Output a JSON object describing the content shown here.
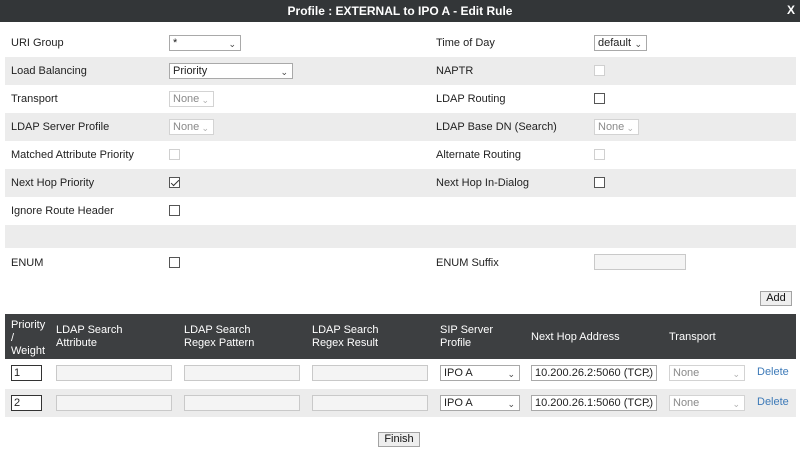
{
  "window": {
    "title": "Profile : EXTERNAL to IPO A - Edit Rule",
    "close_label": "X"
  },
  "form": {
    "left_rows": [
      {
        "label": "URI Group",
        "control": "select",
        "value": "*"
      },
      {
        "label": "Load Balancing",
        "control": "select",
        "value": "Priority"
      },
      {
        "label": "Transport",
        "control": "select",
        "value": "None",
        "disabled": true
      },
      {
        "label": "LDAP Server Profile",
        "control": "select",
        "value": "None",
        "disabled": true
      },
      {
        "label": "Matched Attribute Priority",
        "control": "checkbox",
        "checked": false,
        "disabled": true
      },
      {
        "label": "Next Hop Priority",
        "control": "checkbox",
        "checked": true
      },
      {
        "label": "Ignore Route Header",
        "control": "checkbox",
        "checked": false
      },
      {
        "label": "ENUM",
        "control": "checkbox",
        "checked": false
      }
    ],
    "right_rows": [
      {
        "label": "Time of Day",
        "control": "select",
        "value": "default"
      },
      {
        "label": "NAPTR",
        "control": "checkbox",
        "checked": false,
        "disabled": true
      },
      {
        "label": "LDAP Routing",
        "control": "checkbox",
        "checked": false
      },
      {
        "label": "LDAP Base DN (Search)",
        "control": "select",
        "value": "None",
        "disabled": true
      },
      {
        "label": "Alternate Routing",
        "control": "checkbox",
        "checked": false,
        "disabled": true
      },
      {
        "label": "Next Hop In-Dialog",
        "control": "checkbox",
        "checked": false
      },
      {
        "label": "ENUM Suffix",
        "control": "text",
        "value": ""
      }
    ]
  },
  "add_button": "Add",
  "table": {
    "headers": {
      "priority": "Priority / Weight",
      "ldap_attr": "LDAP Search Attribute",
      "ldap_regex": "LDAP Search Regex Pattern",
      "ldap_result": "LDAP Search Regex Result",
      "sip_profile": "SIP Server Profile",
      "next_hop": "Next Hop Address",
      "transport": "Transport"
    },
    "rows": [
      {
        "priority": "1",
        "ldap_attr": "",
        "ldap_regex": "",
        "ldap_result": "",
        "sip_profile": "IPO A",
        "next_hop": "10.200.26.2:5060 (TCP)",
        "transport": "None",
        "action": "Delete"
      },
      {
        "priority": "2",
        "ldap_attr": "",
        "ldap_regex": "",
        "ldap_result": "",
        "sip_profile": "IPO A",
        "next_hop": "10.200.26.1:5060 (TCP)",
        "transport": "None",
        "action": "Delete"
      }
    ]
  },
  "finish_button": "Finish"
}
